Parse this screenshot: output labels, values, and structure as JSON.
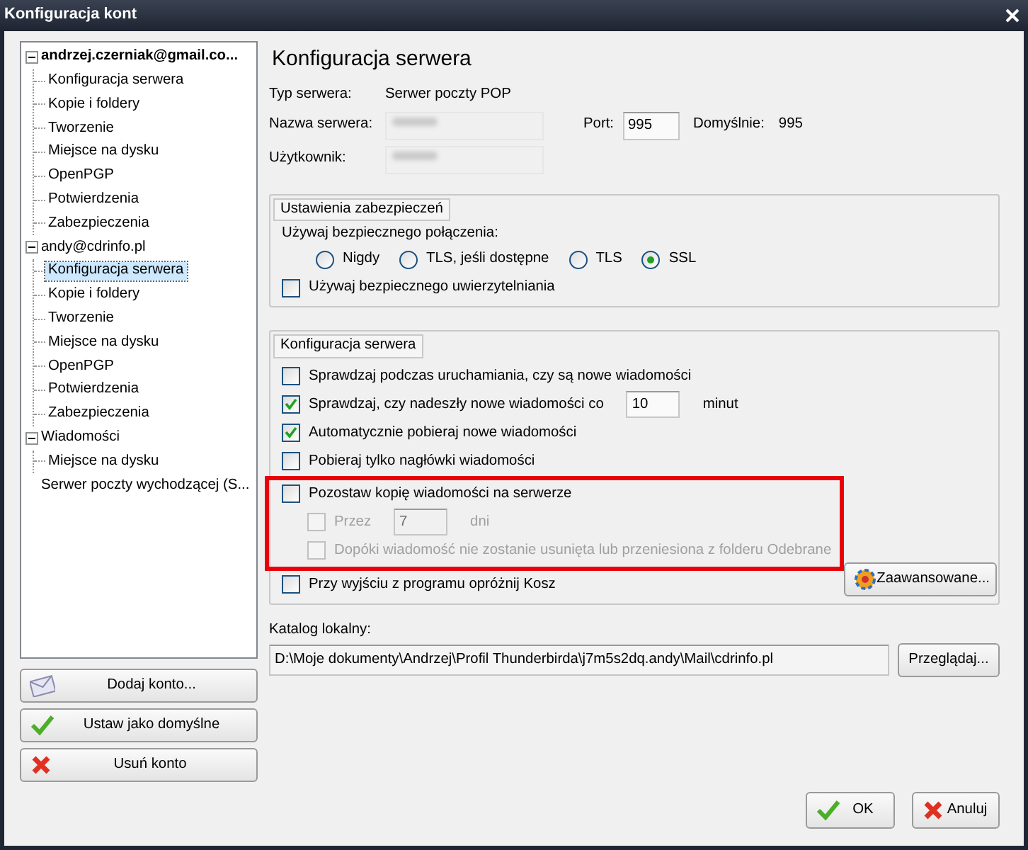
{
  "window": {
    "title": "Konfiguracja kont"
  },
  "tree": [
    {
      "kind": "group",
      "label": "andrzej.czerniak@gmail.co...",
      "bold": true,
      "expanded": true,
      "selected": false,
      "children": [
        {
          "label": "Konfiguracja serwera",
          "selected": false
        },
        {
          "label": "Kopie i foldery",
          "selected": false
        },
        {
          "label": "Tworzenie",
          "selected": false
        },
        {
          "label": "Miejsce na dysku",
          "selected": false
        },
        {
          "label": "OpenPGP",
          "selected": false
        },
        {
          "label": "Potwierdzenia",
          "selected": false
        },
        {
          "label": "Zabezpieczenia",
          "selected": false
        }
      ]
    },
    {
      "kind": "group",
      "label": "andy@cdrinfo.pl",
      "bold": false,
      "expanded": true,
      "selected": false,
      "children": [
        {
          "label": "Konfiguracja serwera",
          "selected": true
        },
        {
          "label": "Kopie i foldery",
          "selected": false
        },
        {
          "label": "Tworzenie",
          "selected": false
        },
        {
          "label": "Miejsce na dysku",
          "selected": false
        },
        {
          "label": "OpenPGP",
          "selected": false
        },
        {
          "label": "Potwierdzenia",
          "selected": false
        },
        {
          "label": "Zabezpieczenia",
          "selected": false
        }
      ]
    },
    {
      "kind": "group",
      "label": "Wiadomości",
      "bold": false,
      "expanded": true,
      "selected": false,
      "children": [
        {
          "label": "Miejsce na dysku",
          "selected": false
        }
      ]
    },
    {
      "kind": "leaf",
      "label": "Serwer poczty wychodzącej (S...",
      "bold": false,
      "selected": false
    }
  ],
  "account_buttons": [
    {
      "label": "Dodaj konto...",
      "kind": "envelope"
    },
    {
      "label": "Ustaw jako domyślne",
      "kind": "check"
    },
    {
      "label": "Usuń konto",
      "kind": "cross"
    }
  ],
  "heading": "Konfiguracja serwera",
  "server_type": {
    "label": "Typ serwera:",
    "value": "Serwer poczty POP"
  },
  "server_name": {
    "label": "Nazwa serwera:"
  },
  "port": {
    "label": "Port:",
    "value": "995"
  },
  "default_port": {
    "label": "Domyślnie:",
    "value": "995"
  },
  "user": {
    "label": "Użytkownik:"
  },
  "security": {
    "legend": "Ustawienia zabezpieczeń",
    "prompt": "Używaj bezpiecznego połączenia:",
    "radios": [
      {
        "label": "Nigdy",
        "selected": false
      },
      {
        "label": "TLS, jeśli dostępne",
        "selected": false
      },
      {
        "label": "TLS",
        "selected": false
      },
      {
        "label": "SSL",
        "selected": true
      }
    ],
    "secure_auth": {
      "label": "Używaj bezpiecznego uwierzytelniania",
      "checked": false
    }
  },
  "server_config": {
    "legend": "Konfiguracja serwera",
    "advanced_button": "Zaawansowane...",
    "options": [
      {
        "kind": "checkbox",
        "label": "Sprawdzaj podczas uruchamiania, czy są nowe wiadomości",
        "checked": false,
        "disabled": false
      },
      {
        "kind": "interval",
        "label": "Sprawdzaj, czy nadeszły nowe wiadomości co",
        "value": "10",
        "unit": "minut",
        "checked": true,
        "disabled": false
      },
      {
        "kind": "checkbox",
        "label": "Automatycznie pobieraj nowe wiadomości",
        "checked": true,
        "disabled": false
      },
      {
        "kind": "checkbox",
        "label": "Pobieraj tylko nagłówki wiadomości",
        "checked": false,
        "disabled": false
      },
      {
        "kind": "checkbox",
        "label": "Pozostaw kopię wiadomości na serwerze",
        "checked": false,
        "disabled": false,
        "highlighted": true,
        "children": [
          {
            "kind": "interval",
            "label": "Przez",
            "value": "7",
            "unit": "dni",
            "checked": false,
            "disabled": true
          },
          {
            "kind": "checkbox",
            "label": "Dopóki wiadomość nie zostanie usunięta lub przeniesiona z folderu Odebrane",
            "checked": false,
            "disabled": true
          }
        ]
      },
      {
        "kind": "checkbox",
        "label": "Przy wyjściu z programu opróżnij Kosz",
        "checked": false,
        "disabled": false
      }
    ]
  },
  "local_dir": {
    "label": "Katalog lokalny:",
    "value": "D:\\Moje dokumenty\\Andrzej\\Profil Thunderbirda\\j7m5s2dq.andy\\Mail\\cdrinfo.pl",
    "button": "Przeglądaj..."
  },
  "dialog_buttons": [
    {
      "label": "OK",
      "kind": "check"
    },
    {
      "label": "Anuluj",
      "kind": "cross"
    }
  ]
}
